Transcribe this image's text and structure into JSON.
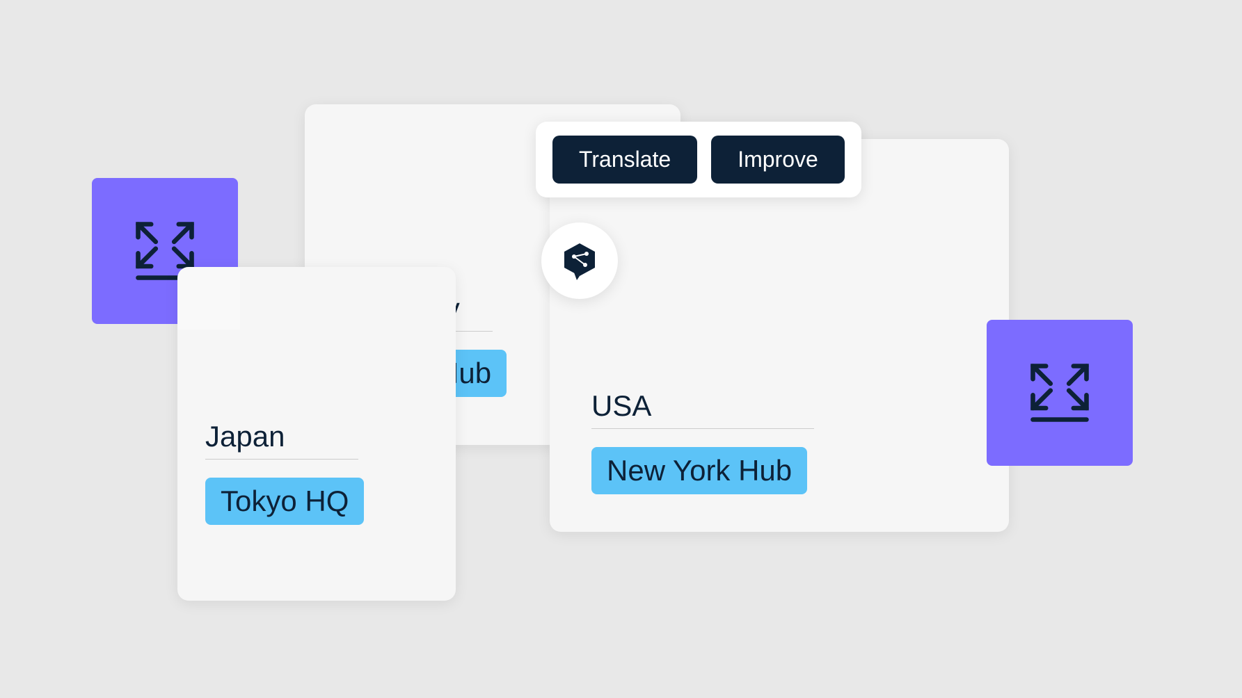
{
  "toolbar": {
    "translate_label": "Translate",
    "improve_label": "Improve"
  },
  "cards": {
    "japan": {
      "country": "Japan",
      "hub": "Tokyo HQ"
    },
    "germany": {
      "country": "Germany",
      "hub": "Berlin Hub"
    },
    "usa": {
      "country": "USA",
      "hub": "New York Hub"
    }
  },
  "colors": {
    "accent_purple": "#7c6cff",
    "dark_navy": "#0d2137",
    "highlight_blue": "#5cc3f7",
    "card_bg": "#f6f6f6"
  },
  "icons": {
    "expand": "expand-icon",
    "translate_logo": "hex-speech-icon"
  }
}
